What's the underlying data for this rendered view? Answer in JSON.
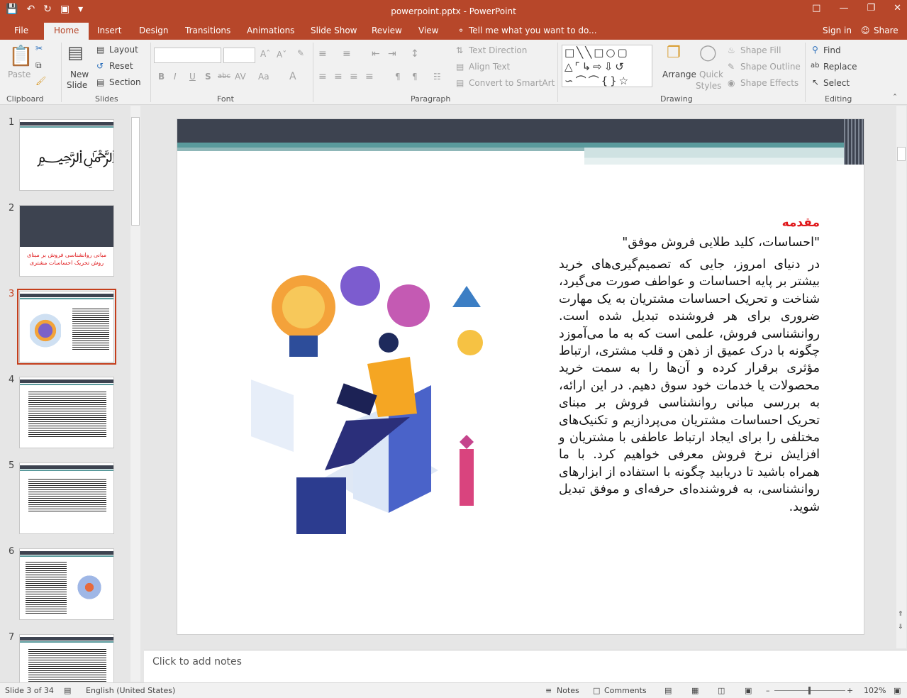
{
  "window": {
    "title": "powerpoint.pptx - PowerPoint"
  },
  "tabs": [
    "File",
    "Home",
    "Insert",
    "Design",
    "Transitions",
    "Animations",
    "Slide Show",
    "Review",
    "View"
  ],
  "tell_me": "Tell me what you want to do...",
  "sign_in": "Sign in",
  "share": "Share",
  "ribbon": {
    "clipboard": {
      "paste": "Paste",
      "label": "Clipboard"
    },
    "slides": {
      "new_slide": "New",
      "new_slide2": "Slide",
      "layout": "Layout",
      "reset": "Reset",
      "section": "Section",
      "label": "Slides"
    },
    "font": {
      "label": "Font",
      "bold": "B",
      "italic": "I",
      "underline": "U",
      "shadow": "S",
      "strike": "abc",
      "spacing": "AV",
      "case": "Aa",
      "color": "A"
    },
    "paragraph": {
      "label": "Paragraph",
      "text_direction": "Text Direction",
      "align_text": "Align Text",
      "smartart": "Convert to SmartArt"
    },
    "drawing": {
      "label": "Drawing",
      "arrange": "Arrange",
      "quick_styles": "Quick",
      "quick_styles2": "Styles",
      "shape_fill": "Shape Fill",
      "shape_outline": "Shape Outline",
      "shape_effects": "Shape Effects"
    },
    "editing": {
      "label": "Editing",
      "find": "Find",
      "replace": "Replace",
      "select": "Select"
    }
  },
  "thumbnails": [
    {
      "num": "1"
    },
    {
      "num": "2",
      "title": "مبانی روانشناسی فروش بر مبنای روش تحریک احساسات مشتری"
    },
    {
      "num": "3"
    },
    {
      "num": "4"
    },
    {
      "num": "5"
    },
    {
      "num": "6"
    },
    {
      "num": "7"
    }
  ],
  "slide": {
    "heading": "مقدمه",
    "subtitle": "\"احساسات، کلید طلایی فروش موفق\"",
    "body": "در دنیای امروز، جایی که تصمیم‌گیری‌های خرید بیشتر بر پایه احساسات و عواطف صورت می‌گیرد، شناخت و تحریک احساسات مشتریان به یک مهارت ضروری برای هر فروشنده تبدیل شده است. روانشناسی فروش، علمی است که به ما می‌آموزد چگونه با درک عمیق از ذهن و قلب مشتری، ارتباط مؤثری برقرار کرده و آن‌ها را به سمت خرید محصولات یا خدمات خود سوق دهیم. در این ارائه، به بررسی مبانی روانشناسی فروش بر مبنای تحریک احساسات مشتریان می‌پردازیم و تکنیک‌های مختلفی را برای ایجاد ارتباط عاطفی با مشتریان و افزایش نرخ فروش معرفی خواهیم کرد. با ما همراه باشید تا دریابید چگونه با استفاده از ابزارهای روانشناسی، به فروشنده‌ای حرفه‌ای و موفق تبدیل شوید.",
    "heading_color": "#e0181b"
  },
  "notes_placeholder": "Click to add notes",
  "status": {
    "slide": "Slide 3 of 34",
    "language": "English (United States)",
    "notes": "Notes",
    "comments": "Comments",
    "zoom": "102%"
  },
  "colors": {
    "accent": "#b7472a",
    "slide_bar": "#3d4350",
    "slide_teal": "#5a9a9c"
  }
}
